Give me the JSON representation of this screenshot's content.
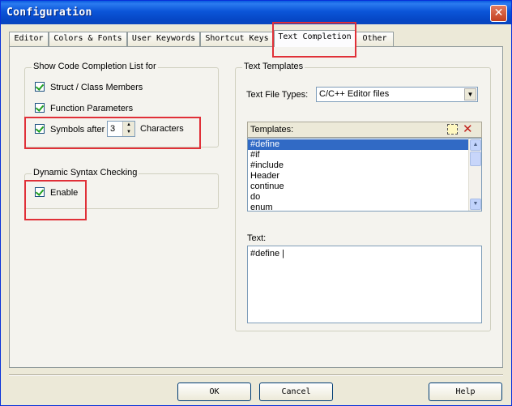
{
  "window": {
    "title": "Configuration",
    "close_glyph": "✕"
  },
  "tabs": [
    {
      "label": "Editor",
      "active": false
    },
    {
      "label": "Colors & Fonts",
      "active": false
    },
    {
      "label": "User Keywords",
      "active": false
    },
    {
      "label": "Shortcut Keys",
      "active": false
    },
    {
      "label": "Text Completion",
      "active": true
    },
    {
      "label": "Other",
      "active": false
    }
  ],
  "completion_group": {
    "label": "Show Code Completion List for",
    "class_members": {
      "label": "Struct / Class Members",
      "checked": true
    },
    "function_params": {
      "label": "Function Parameters",
      "checked": true
    },
    "symbols_after": {
      "label": "Symbols after",
      "checked": true,
      "value": "3",
      "suffix": "Characters"
    }
  },
  "syntax_group": {
    "label": "Dynamic Syntax Checking",
    "enable": {
      "label": "Enable",
      "checked": true
    }
  },
  "templates_group": {
    "label": "Text Templates",
    "file_types_label": "Text File Types:",
    "file_types_value": "C/C++ Editor files",
    "templates_label": "Templates:",
    "templates": [
      "#define",
      "#if",
      "#include",
      "Header",
      "continue",
      "do",
      "enum"
    ],
    "selected_template": "#define",
    "text_label": "Text:",
    "text_value": "#define |"
  },
  "buttons": {
    "ok": "OK",
    "cancel": "Cancel",
    "help": "Help"
  },
  "icons": {
    "new_template": "new-document-icon",
    "delete_template": "delete-x-icon",
    "check_color": "#21a121",
    "annotation_color": "#e03038"
  }
}
